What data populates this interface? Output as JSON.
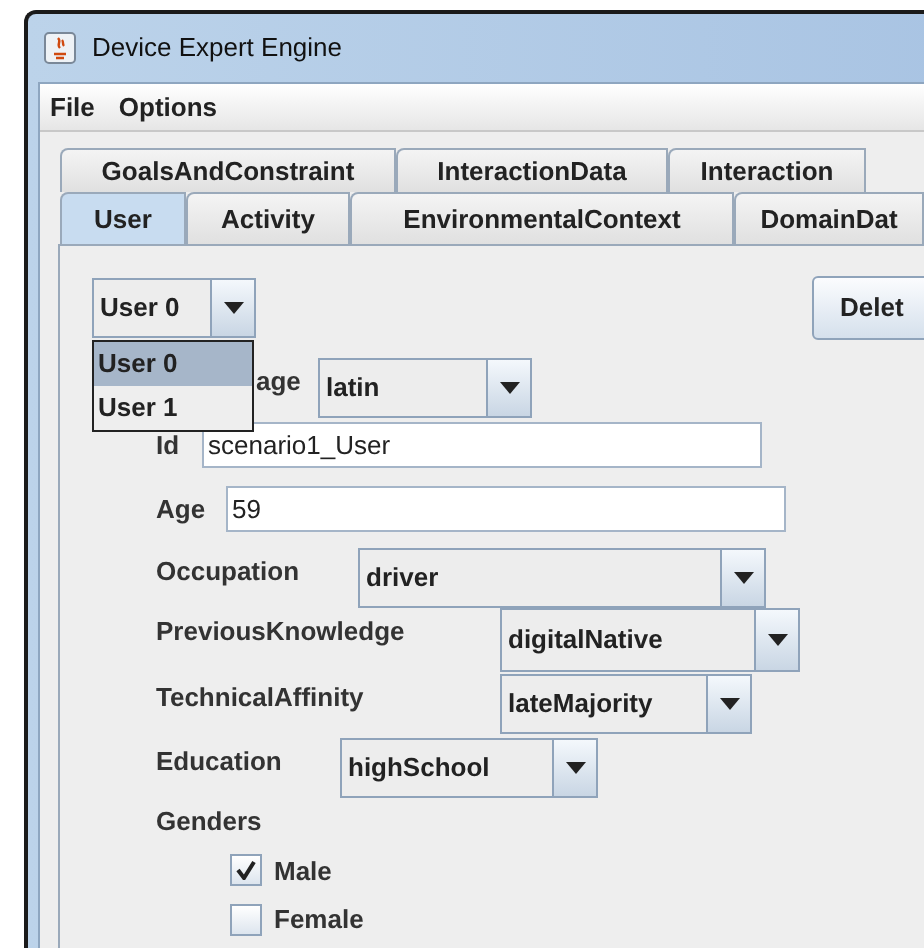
{
  "window": {
    "title": "Device Expert Engine"
  },
  "menu": [
    "File",
    "Options"
  ],
  "tab_rows": [
    [
      {
        "label": "GoalsAndConstraint",
        "selected": false
      },
      {
        "label": "InteractionData",
        "selected": false
      },
      {
        "label": "Interaction",
        "selected": false
      }
    ],
    [
      {
        "label": "User",
        "selected": true
      },
      {
        "label": "Activity",
        "selected": false
      },
      {
        "label": "EnvironmentalContext",
        "selected": false
      },
      {
        "label": "DomainDat",
        "selected": false
      }
    ]
  ],
  "user_selector": {
    "value": "User 0",
    "expanded": true,
    "options": [
      {
        "label": "User 0",
        "selected": true
      },
      {
        "label": "User 1",
        "selected": false
      }
    ]
  },
  "delete_button": "Delet",
  "fields": [
    {
      "kind": "dropdown",
      "label": "age",
      "value": "latin"
    },
    {
      "kind": "text",
      "label": "Id",
      "value": "scenario1_User"
    },
    {
      "kind": "text",
      "label": "Age",
      "value": "59"
    },
    {
      "kind": "dropdown",
      "label": "Occupation",
      "value": "driver"
    },
    {
      "kind": "dropdown",
      "label": "PreviousKnowledge",
      "value": "digitalNative"
    },
    {
      "kind": "dropdown",
      "label": "TechnicalAffinity",
      "value": "lateMajority"
    },
    {
      "kind": "dropdown",
      "label": "Education",
      "value": "highSchool"
    }
  ],
  "genders": {
    "label": "Genders",
    "options": [
      {
        "label": "Male",
        "checked": true
      },
      {
        "label": "Female",
        "checked": false
      }
    ]
  }
}
